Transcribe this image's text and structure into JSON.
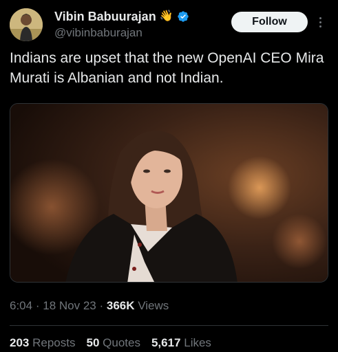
{
  "author": {
    "display_name": "Vibin Babuurajan",
    "emoji": "👋",
    "handle": "@vibinbaburajan",
    "verified": true
  },
  "follow_button": {
    "label": "Follow"
  },
  "tweet": {
    "text": "Indians are upset that the new OpenAI CEO Mira Murati is Albanian and not Indian."
  },
  "meta": {
    "time": "6:04",
    "date": "18 Nov 23",
    "views_count": "366K",
    "views_label": "Views",
    "separator": "·"
  },
  "stats": {
    "reposts_count": "203",
    "reposts_label": "Reposts",
    "quotes_count": "50",
    "quotes_label": "Quotes",
    "likes_count": "5,617",
    "likes_label": "Likes"
  },
  "colors": {
    "background": "#000000",
    "text_primary": "#e7e9ea",
    "text_secondary": "#71767b",
    "verified_blue": "#1d9bf0",
    "follow_bg": "#eff3f4"
  },
  "icons": [
    "avatar",
    "waving-hand-icon",
    "verified-badge-icon",
    "more-options-icon"
  ]
}
